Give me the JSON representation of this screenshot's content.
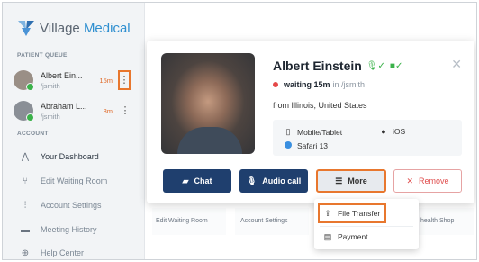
{
  "brand": {
    "word1": "Village",
    "word2": "Medical"
  },
  "sidebar": {
    "queue_label": "PATIENT QUEUE",
    "account_label": "ACCOUNT",
    "patients": [
      {
        "name": "Albert Ein...",
        "handle": "/jsmith",
        "wait": "15m"
      },
      {
        "name": "Abraham L...",
        "handle": "/jsmith",
        "wait": "8m"
      }
    ],
    "dots_glyph": "⋮",
    "nav": [
      {
        "label": "Your Dashboard",
        "icon": "dashboard-icon"
      },
      {
        "label": "Edit Waiting Room",
        "icon": "waiting-room-icon"
      },
      {
        "label": "Account Settings",
        "icon": "sliders-icon"
      },
      {
        "label": "Meeting History",
        "icon": "video-history-icon"
      },
      {
        "label": "Help Center",
        "icon": "help-icon"
      }
    ]
  },
  "background_tiles": {
    "edit_waiting_room": "Edit Waiting Room",
    "account_settings": "Account Settings",
    "health_shop": "health Shop"
  },
  "popup": {
    "patient_name": "Albert Einstein",
    "mic_status": "✓",
    "cam_status": "✓",
    "waiting": "waiting 15m",
    "waiting_in": "in /jsmith",
    "from": "from Illinois, United States",
    "device": "Mobile/Tablet",
    "os": "iOS",
    "browser": "Safari 13",
    "buttons": {
      "chat": "Chat",
      "audio": "Audio call",
      "more": "More",
      "remove": "Remove"
    },
    "menu": {
      "file_transfer": "File Transfer",
      "payment": "Payment"
    }
  },
  "colors": {
    "accent_navy": "#1f3f6e",
    "highlight_orange": "#e8772e",
    "status_green": "#3bb24a",
    "status_red": "#e54848",
    "brand_blue": "#2f8fd0"
  }
}
